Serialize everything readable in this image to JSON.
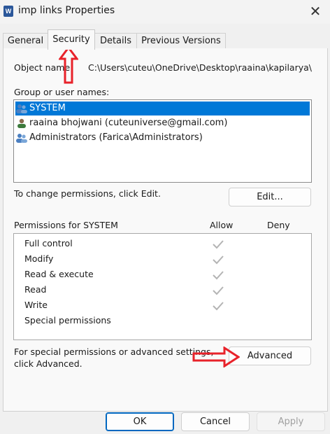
{
  "window": {
    "title": "imp links Properties",
    "app_icon_letter": "W",
    "close_glyph": "✕"
  },
  "tabs": [
    {
      "label": "General"
    },
    {
      "label": "Security"
    },
    {
      "label": "Details"
    },
    {
      "label": "Previous Versions"
    }
  ],
  "security": {
    "object_name_label": "Object name:",
    "object_name_value": "C:\\Users\\cuteu\\OneDrive\\Desktop\\raaina\\kapilarya\\im",
    "groups_label": "Group or user names:",
    "groups": [
      {
        "name": "SYSTEM",
        "icon": "users-group-icon",
        "selected": true
      },
      {
        "name": "raaina bhojwani (cuteuniverse@gmail.com)",
        "icon": "user-icon",
        "selected": false
      },
      {
        "name": "Administrators (Farica\\Administrators)",
        "icon": "users-group-icon",
        "selected": false
      }
    ],
    "change_text": "To change permissions, click Edit.",
    "edit_button": "Edit...",
    "permissions_label": "Permissions for SYSTEM",
    "allow_header": "Allow",
    "deny_header": "Deny",
    "permissions": [
      {
        "name": "Full control",
        "allow": true,
        "deny": false
      },
      {
        "name": "Modify",
        "allow": true,
        "deny": false
      },
      {
        "name": "Read & execute",
        "allow": true,
        "deny": false
      },
      {
        "name": "Read",
        "allow": true,
        "deny": false
      },
      {
        "name": "Write",
        "allow": true,
        "deny": false
      },
      {
        "name": "Special permissions",
        "allow": false,
        "deny": false
      }
    ],
    "advanced_text_line1": "For special permissions or advanced settings,",
    "advanced_text_line2": "click Advanced.",
    "advanced_button": "Advanced"
  },
  "footer": {
    "ok": "OK",
    "cancel": "Cancel",
    "apply": "Apply"
  },
  "colors": {
    "selection": "#0078d7",
    "annotation_arrow": "#e8222a",
    "check_gray": "#b4b4b4"
  }
}
